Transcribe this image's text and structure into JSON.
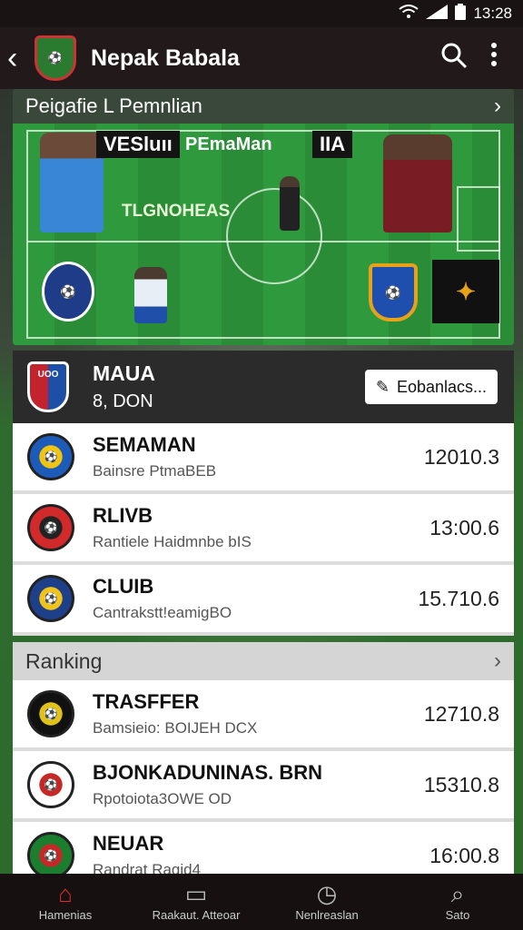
{
  "status": {
    "time": "13:28",
    "icons": [
      "wifi-icon",
      "signal-icon",
      "battery-icon"
    ]
  },
  "appbar": {
    "title": "Nepak Babala"
  },
  "feature": {
    "heading": "Peigafie L Pemnlian",
    "tag_left": "VESluıı",
    "tag_left_2": "PEmaMan",
    "tag_right": "IIA",
    "pitch_label": "TLGNOHEAS"
  },
  "match": {
    "name": "MAUA",
    "subtitle": "8, DON",
    "badge": "UOO",
    "button_label": "Eobanlacs..."
  },
  "list_top": [
    {
      "name": "SEMAMAN",
      "sub": "Bainsre PtmaBEB",
      "value": "12010.3",
      "badge_color": "#1c5bb8",
      "badge_accent": "#f1c40f"
    },
    {
      "name": "RLIVB",
      "sub": "Rantiele Haidmnbe bIS",
      "value": "13:00.6",
      "badge_color": "#d22a2a",
      "badge_accent": "#222222"
    },
    {
      "name": "CLUIB",
      "sub": "Cantrakstt!eamigBO",
      "value": "15.710.6",
      "badge_color": "#1e3f8a",
      "badge_accent": "#f0c419"
    }
  ],
  "section": {
    "label": "Ranking"
  },
  "list_bottom": [
    {
      "name": "TRASFFER",
      "sub": "Bamsieio: BOIJEH DCX",
      "value": "12710.8",
      "badge_color": "#111111",
      "badge_accent": "#e0c21a"
    },
    {
      "name": "BJONKADUNINAS. BRN",
      "sub": "Rpotoiota3OWE OD",
      "value": "15310.8",
      "badge_color": "#ffffff",
      "badge_accent": "#c62828"
    },
    {
      "name": "NEUAR",
      "sub": "Randrat Ragid4",
      "value": "16:00.8",
      "badge_color": "#1b7d2e",
      "badge_accent": "#c62828"
    }
  ],
  "bottom_nav": [
    {
      "label": "Hamenias",
      "icon": "home-icon"
    },
    {
      "label": "Raakaut. Atteoar",
      "icon": "screen-icon"
    },
    {
      "label": "Nenlreaslan",
      "icon": "clock-icon"
    },
    {
      "label": "Sato",
      "icon": "search-icon"
    }
  ],
  "colors": {
    "accent": "#e02b2b",
    "appbar": "#21191a",
    "pitch": "#2f9a3d"
  }
}
